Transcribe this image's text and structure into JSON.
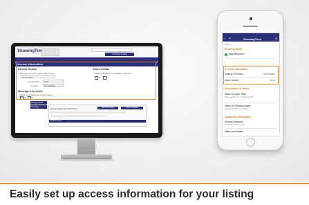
{
  "caption": "Easily set up access information for your listing",
  "colors": {
    "brand": "#2a2f7a",
    "highlight": "#f28c28"
  },
  "desktop": {
    "logo": "ShowingTime",
    "tab": "",
    "header_button": "Add New Listing",
    "section_title": "Access Information",
    "access_column": {
      "heading": "Access Details",
      "line1": "How can the agent access the home?",
      "dropdown_value": "Combination",
      "combination_label": "Combination",
      "combination_value": "1234",
      "location_label": "Location",
      "location_value": "Front Railing"
    },
    "alarm_column": {
      "heading": "Alarm Details",
      "line1": "Should the alarm be provided to agents?",
      "option1": "Yes",
      "option2": "No"
    },
    "message_key": {
      "heading": "Message Key Views",
      "line1": "Access is provided to a buyer agent",
      "option1": "Yes",
      "option2": "No"
    },
    "side_items": [
      "Listing Details",
      "Showing Instructions"
    ],
    "panel": {
      "heading": "Special Showing Instructions",
      "button1": "Add Instructions",
      "button2": "Save Changes",
      "footer": "Access Times"
    }
  },
  "mobile": {
    "agent_label": "AGENT",
    "logo": "ShowingTime",
    "sections": [
      {
        "title": "Showing Mode",
        "items": [
          {
            "label": "Appt Required",
            "value": "",
            "dot": true
          }
        ]
      },
      {
        "title": "Access Information",
        "items": [
          {
            "label": "Method of Access",
            "value": "Combination"
          },
          {
            "label": "Alarm Details",
            "value": "None"
          }
        ]
      },
      {
        "title": "Instructions & Notes",
        "items": [
          {
            "label": "Notes for Appt. Staff",
            "sub": "Notes shown only to showing staff"
          },
          {
            "label": "Notes for Showing Agent",
            "sub": "Displayed to showing agents"
          }
        ]
      },
      {
        "title": "Additional Information",
        "items": [
          {
            "label": "Driving Directions",
            "sub": "Directions to the property"
          },
          {
            "label": "Notes and Details",
            "sub": ""
          }
        ]
      }
    ]
  }
}
